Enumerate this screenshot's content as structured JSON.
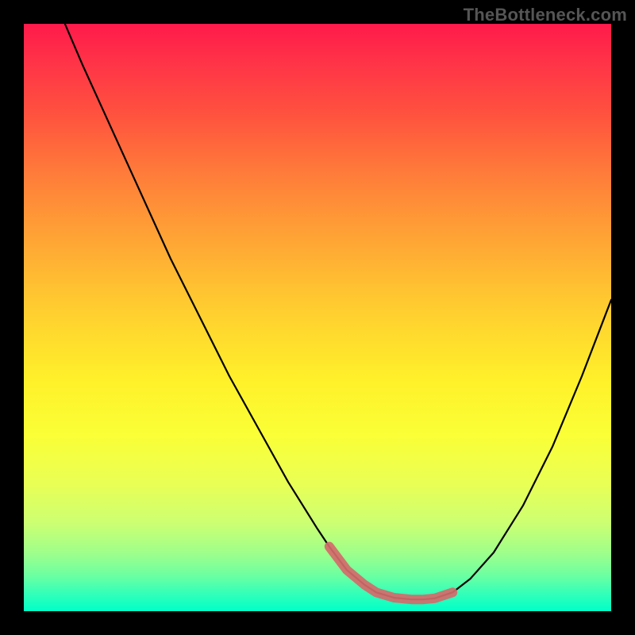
{
  "watermark": "TheBottleneck.com",
  "chart_data": {
    "type": "line",
    "title": "",
    "xlabel": "",
    "ylabel": "",
    "xlim": [
      0,
      100
    ],
    "ylim": [
      0,
      100
    ],
    "series": [
      {
        "name": "curve",
        "x": [
          7,
          10,
          15,
          20,
          25,
          30,
          35,
          40,
          45,
          50,
          52,
          55,
          58,
          60,
          63,
          66,
          68,
          70,
          73,
          76,
          80,
          85,
          90,
          95,
          100
        ],
        "values": [
          100,
          93,
          82,
          71,
          60,
          50,
          40,
          31,
          22,
          14,
          11,
          7,
          4.5,
          3.2,
          2.3,
          2,
          2,
          2.2,
          3.2,
          5.5,
          10,
          18,
          28,
          40,
          53
        ]
      },
      {
        "name": "highlight",
        "x": [
          52,
          55,
          58,
          60,
          63,
          66,
          68,
          70,
          73
        ],
        "values": [
          11,
          7,
          4.5,
          3.2,
          2.3,
          2,
          2,
          2.2,
          3.2
        ]
      }
    ],
    "colors": {
      "curve": "#000000",
      "highlight": "#d46a6a"
    }
  }
}
